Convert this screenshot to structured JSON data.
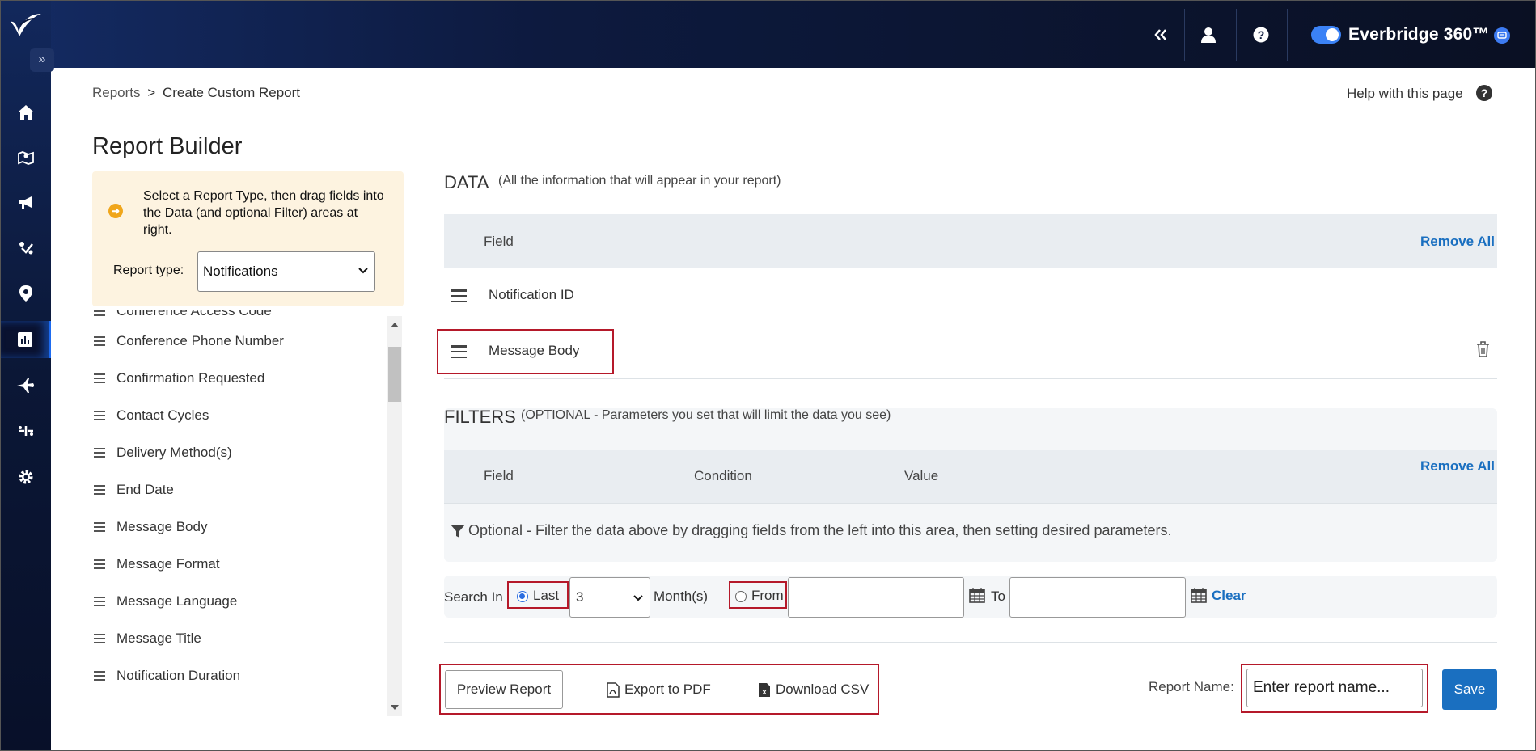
{
  "topbar": {
    "brand": "Everbridge 360™"
  },
  "breadcrumb": {
    "root": "Reports",
    "separator": ">",
    "current": "Create Custom Report"
  },
  "help": {
    "label": "Help with this page"
  },
  "page_title": "Report Builder",
  "instructions": "Select a Report Type, then drag fields into the Data (and optional Filter) areas at right.",
  "report_type": {
    "label": "Report type:",
    "value": "Notifications"
  },
  "field_list": [
    "Conference Access Code",
    "Conference Phone Number",
    "Confirmation Requested",
    "Contact Cycles",
    "Delivery Method(s)",
    "End Date",
    "Message Body",
    "Message Format",
    "Message Language",
    "Message Title",
    "Notification Duration"
  ],
  "data_section": {
    "title": "DATA",
    "subtitle": "(All the information that will appear in your report)",
    "column_field": "Field",
    "remove_all": "Remove All",
    "rows": [
      "Notification ID",
      "Message Body"
    ]
  },
  "filters_section": {
    "title": "FILTERS",
    "subtitle": "(OPTIONAL - Parameters you set that will limit the data you see)",
    "columns": [
      "Field",
      "Condition",
      "Value"
    ],
    "remove_all": "Remove All",
    "hint": "Optional - Filter the data above by dragging fields from the left into this area, then setting desired parameters."
  },
  "search": {
    "label": "Search In",
    "last_label": "Last",
    "last_selected": true,
    "last_value": "3",
    "unit": "Month(s)",
    "from_label": "From",
    "to_label": "To",
    "clear": "Clear"
  },
  "actions": {
    "preview": "Preview Report",
    "export_pdf": "Export to PDF",
    "download_csv": "Download CSV",
    "report_name_label": "Report Name:",
    "report_name_placeholder": "Enter report name...",
    "save": "Save"
  },
  "colors": {
    "accent": "#1a6fc0",
    "highlight": "#b5192a",
    "info_bg": "#fdf3e0",
    "nav_bg": "#0b1736"
  },
  "icons": [
    "logo-icon",
    "expand-icon",
    "home-icon",
    "map-icon",
    "megaphone-icon",
    "incident-icon",
    "location-icon",
    "reports-icon",
    "travel-icon",
    "integration-icon",
    "settings-icon",
    "collapse-icon",
    "user-icon",
    "help-icon",
    "chat-icon",
    "trash-icon",
    "filter-icon",
    "calendar-icon",
    "pdf-icon",
    "csv-icon"
  ]
}
